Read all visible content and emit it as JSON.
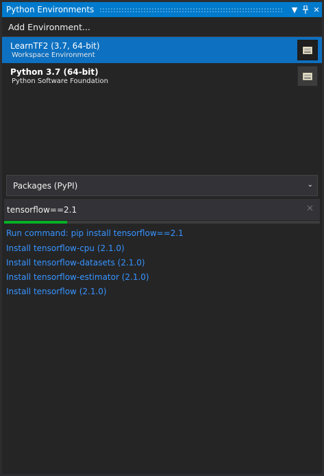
{
  "window": {
    "title": "Python Environments"
  },
  "toolbar": {
    "add_environment": "Add Environment..."
  },
  "environments": [
    {
      "name": "LearnTF2 (3.7, 64-bit)",
      "subtitle": "Workspace Environment",
      "selected": true
    },
    {
      "name": "Python 3.7 (64-bit)",
      "subtitle": "Python Software Foundation",
      "selected": false
    }
  ],
  "packages": {
    "selected_source": "Packages (PyPI)"
  },
  "search": {
    "value": "tensorflow==2.1",
    "progress_percent": 20
  },
  "results": [
    "Run command: pip install tensorflow==2.1",
    "Install tensorflow-cpu (2.1.0)",
    "Install tensorflow-datasets (2.1.0)",
    "Install tensorflow-estimator (2.1.0)",
    "Install tensorflow (2.1.0)"
  ],
  "colors": {
    "accent": "#007acc",
    "selection": "#0e70c0",
    "link": "#3794ff",
    "progress": "#06b025"
  }
}
